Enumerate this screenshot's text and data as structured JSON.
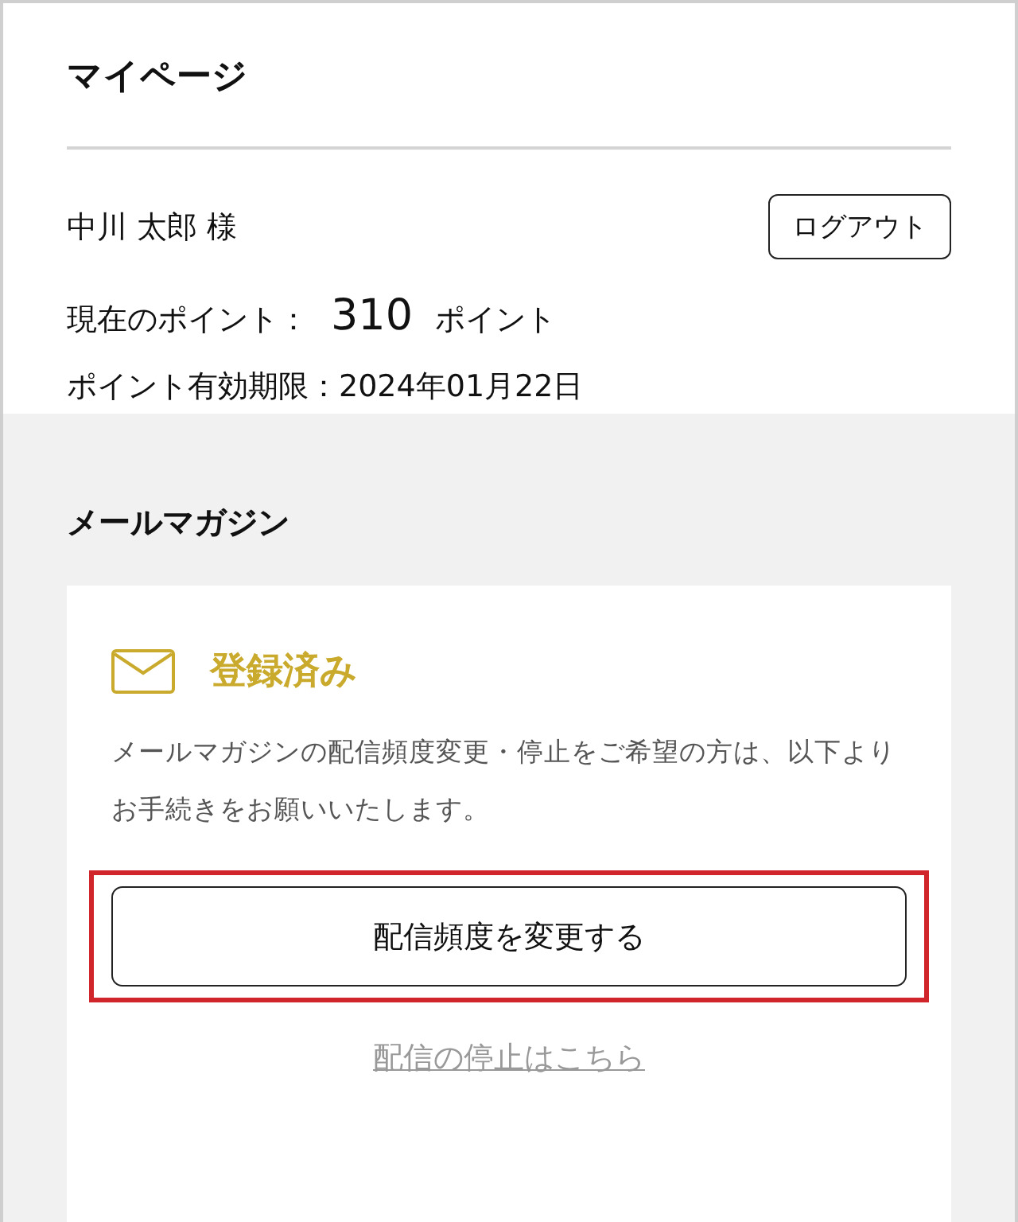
{
  "page_title": "マイページ",
  "account": {
    "name": "中川 太郎 様",
    "logout_button": "ログアウト",
    "points_label": "現在のポイント：",
    "points_value": "310",
    "points_unit": "ポイント",
    "expiry": "ポイント有効期限：2024年01月22日"
  },
  "newsletter": {
    "heading": "メールマガジン",
    "subscribed": true,
    "status": "登録済み",
    "description": "メールマガジンの配信頻度変更・停止をご希望の方は、以下よりお手続きをお願いいたします。",
    "change_button": {
      "label": "配信頻度を変更する",
      "highlighted": true
    },
    "unsubscribe_link": "配信の停止はこちら"
  }
}
